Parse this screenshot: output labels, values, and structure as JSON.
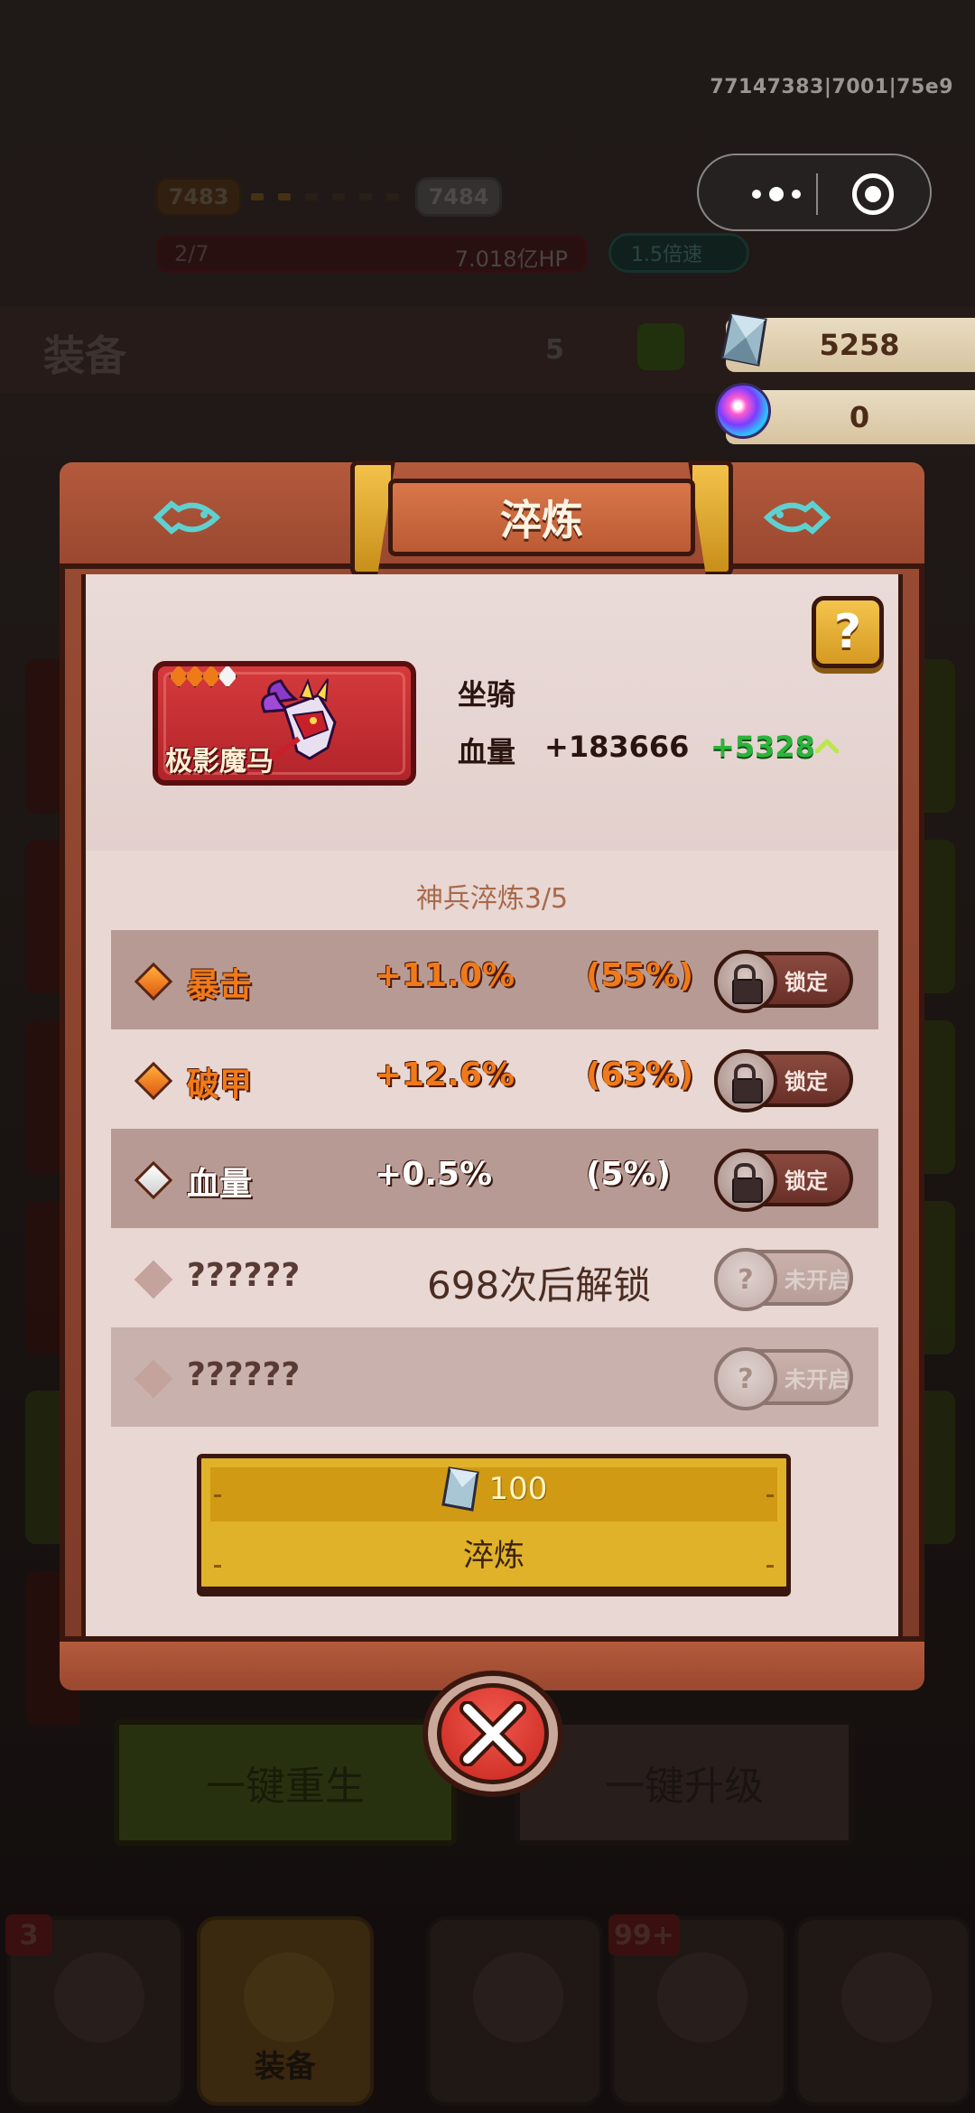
{
  "system": {
    "build_id": "77147383|7001|75e9"
  },
  "background": {
    "level_current": "7483",
    "level_next": "7484",
    "stage": "2/7",
    "boss_hp": "7.018亿HP",
    "speed": "1.5倍速",
    "section_title": "装备",
    "count": "5",
    "resources": {
      "gems": "5258",
      "orbs": "0"
    },
    "btn_rebirth": "一键重生",
    "btn_upgrade": "一键升级",
    "nav": [
      {
        "badge": "3",
        "label": ""
      },
      {
        "badge": "",
        "label": "装备"
      },
      {
        "badge": "",
        "label": ""
      },
      {
        "badge": "99+",
        "label": ""
      },
      {
        "badge": "",
        "label": ""
      }
    ]
  },
  "modal": {
    "title": "淬炼",
    "help": "?",
    "item": {
      "name": "极影魔马",
      "type": "坐骑",
      "stat_name": "血量",
      "stat_value": "+183666",
      "stat_increase": "+5328"
    },
    "refine_progress": "神兵淬炼3/5",
    "attributes": [
      {
        "name": "暴击",
        "value": "+11.0%",
        "percent": "(55%)",
        "button": "锁定",
        "quality": "orange"
      },
      {
        "name": "破甲",
        "value": "+12.6%",
        "percent": "(63%)",
        "button": "锁定",
        "quality": "orange"
      },
      {
        "name": "血量",
        "value": "+0.5%",
        "percent": "(5%)",
        "button": "锁定",
        "quality": "white"
      },
      {
        "name": "??????",
        "unlock_hint": "698次后解锁",
        "button": "未开启",
        "quality": "locked"
      },
      {
        "name": "??????",
        "unlock_hint": "",
        "button": "未开启",
        "quality": "locked"
      }
    ],
    "refine_cost": "100",
    "refine_button": "淬炼"
  },
  "colors": {
    "accent_orange": "#f07a1a",
    "increase_green": "#2bb33b",
    "button_gold": "#e0b22a",
    "close_red": "#d4342a"
  },
  "icons": [
    "help-icon",
    "lock-icon",
    "unknown-icon",
    "gem-icon",
    "orb-icon",
    "close-icon",
    "fish-icon",
    "arrow-up-icon"
  ]
}
